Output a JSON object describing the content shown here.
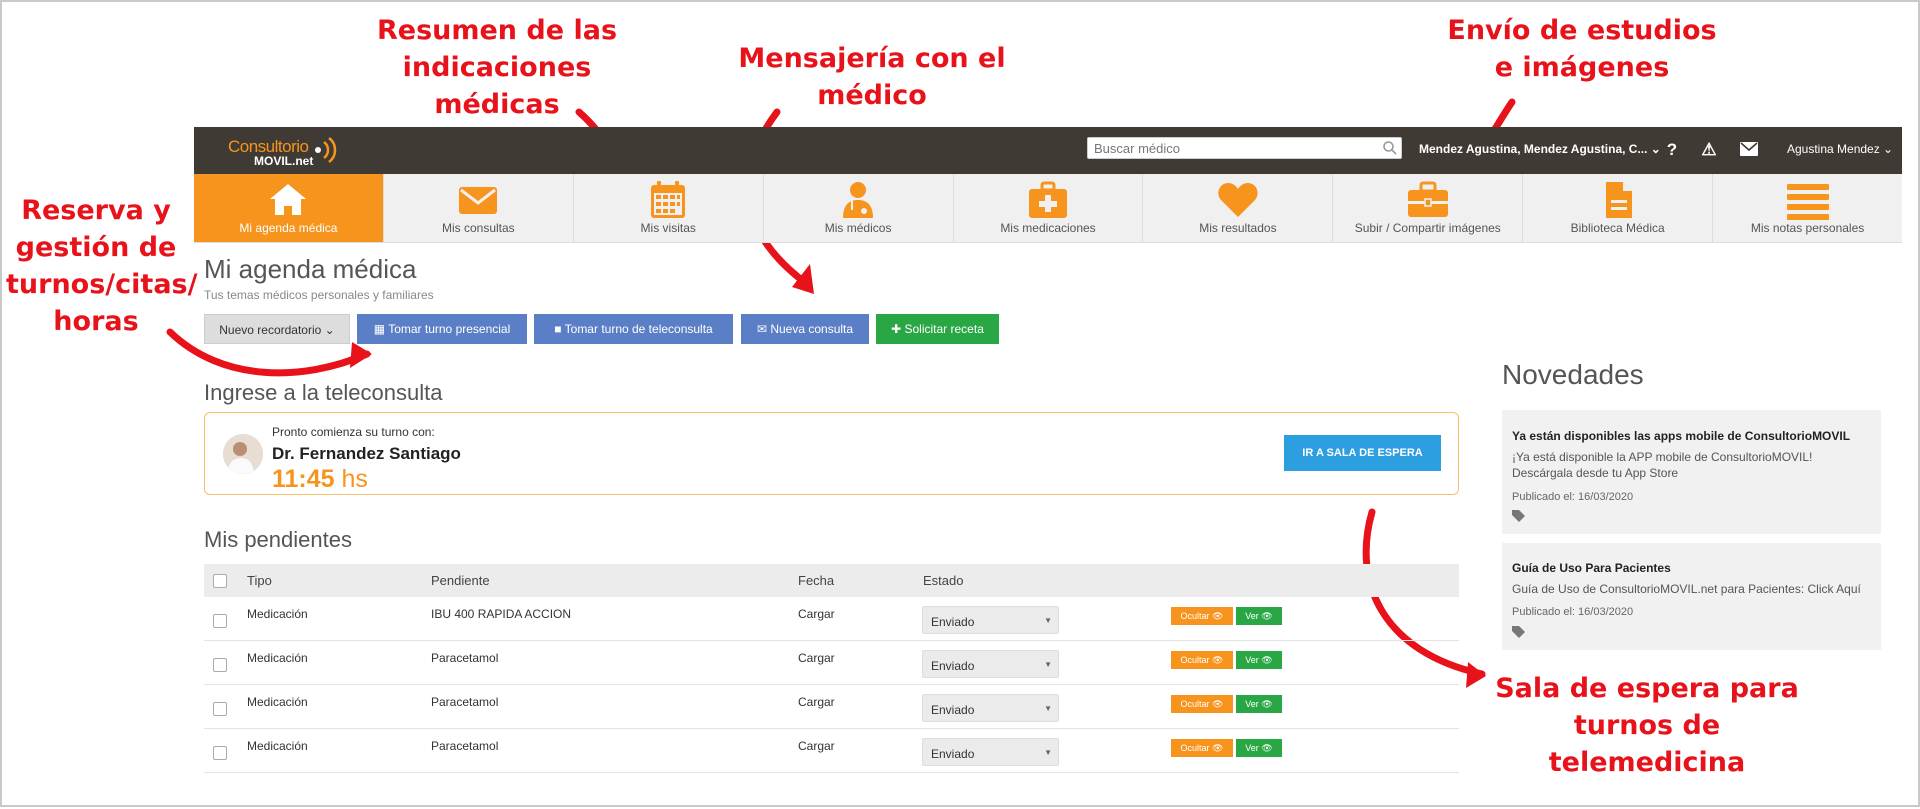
{
  "annotations": {
    "resumen": "Resumen de las\nindicaciones médicas",
    "mensajeria": "Mensajería con el\nmédico",
    "envio": "Envío de estudios\ne imágenes",
    "reserva": "Reserva y\ngestión de\nturnos/citas/\nhoras",
    "sala": "Sala de espera para\nturnos de telemedicina"
  },
  "topbar": {
    "logo_line1": "Consultorio",
    "logo_line2": "MOVIL.net",
    "search_placeholder": "Buscar médico",
    "user_select": "Mendez Agustina, Mendez Agustina, C... ⌄",
    "help": "?",
    "alert": "⚠",
    "user_name": "Agustina Mendez ⌄"
  },
  "nav": [
    {
      "label": "Mi agenda médica",
      "icon": "house-icon"
    },
    {
      "label": "Mis consultas",
      "icon": "envelope-icon"
    },
    {
      "label": "Mis visitas",
      "icon": "calendar-icon"
    },
    {
      "label": "Mis médicos",
      "icon": "doctor-icon"
    },
    {
      "label": "Mis medicaciones",
      "icon": "first-aid-kit-icon"
    },
    {
      "label": "Mis resultados",
      "icon": "heart-icon"
    },
    {
      "label": "Subir / Compartir imágenes",
      "icon": "briefcase-icon"
    },
    {
      "label": "Biblioteca Médica",
      "icon": "document-icon"
    },
    {
      "label": "Mis notas personales",
      "icon": "list-icon"
    }
  ],
  "page": {
    "title": "Mi agenda médica",
    "subtitle": "Tus temas médicos personales y familiares",
    "buttons": {
      "nuevo": "Nuevo recordatorio ⌄",
      "turno": "Tomar turno presencial",
      "tele": "Tomar turno de teleconsulta",
      "consulta": "Nueva consulta",
      "receta": "Solicitar receta"
    }
  },
  "teleconsulta": {
    "heading": "Ingrese a la teleconsulta",
    "pre": "Pronto comienza su turno con:",
    "doctor": "Dr. Fernandez Santiago",
    "time": "11:45",
    "time_unit": "hs",
    "button": "IR A SALA DE ESPERA"
  },
  "pendientes": {
    "heading": "Mis pendientes",
    "columns": {
      "tipo": "Tipo",
      "pendiente": "Pendiente",
      "fecha": "Fecha",
      "estado": "Estado"
    },
    "rows": [
      {
        "tipo": "Medicación",
        "pendiente": "IBU 400 RAPIDA ACCION",
        "fecha": "Cargar",
        "estado": "Enviado",
        "ocultar": "Ocultar 👁",
        "ver": "Ver 👁"
      },
      {
        "tipo": "Medicación",
        "pendiente": "Paracetamol",
        "fecha": "Cargar",
        "estado": "Enviado",
        "ocultar": "Ocultar 👁",
        "ver": "Ver 👁"
      },
      {
        "tipo": "Medicación",
        "pendiente": "Paracetamol",
        "fecha": "Cargar",
        "estado": "Enviado",
        "ocultar": "Ocultar 👁",
        "ver": "Ver 👁"
      },
      {
        "tipo": "Medicación",
        "pendiente": "Paracetamol",
        "fecha": "Cargar",
        "estado": "Enviado",
        "ocultar": "Ocultar 👁",
        "ver": "Ver 👁"
      }
    ]
  },
  "novedades": {
    "heading": "Novedades",
    "items": [
      {
        "title": "Ya están disponibles las apps mobile de ConsultorioMOVIL",
        "body": "¡Ya está disponible la APP mobile de ConsultorioMOVIL! Descárgala desde tu App Store",
        "published": "Publicado el: 16/03/2020"
      },
      {
        "title": "Guía de Uso Para Pacientes",
        "body": "Guía de Uso de ConsultorioMOVIL.net para Pacientes: Click Aquí",
        "published": "Publicado el: 16/03/2020"
      }
    ]
  },
  "colors": {
    "accent": "#f7941d",
    "annotation": "#e8121b",
    "topbar": "#3f3b34",
    "button_blue": "#5b7fc7",
    "button_green": "#29a745",
    "cta_blue": "#2c9fe0"
  }
}
